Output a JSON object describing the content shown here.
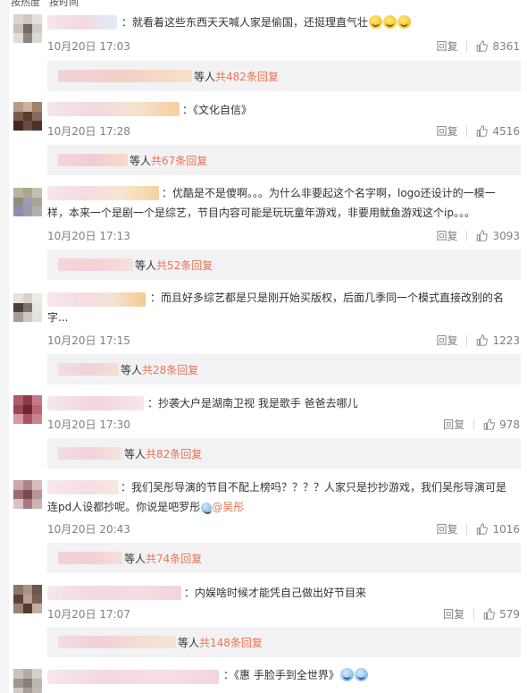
{
  "sort": {
    "hot": "按热度",
    "time": "按时间"
  },
  "labels": {
    "reply": "回复",
    "others": "等人"
  },
  "colors": {
    "accent": "#eb7350",
    "muted": "#808080",
    "subBg": "#f2f2f5"
  },
  "comments": [
    {
      "text": "：就看着这些东西天天喊人家是偷国，还挺理直气壮",
      "emoji": [
        "grin-icon",
        "grin-icon",
        "grin-icon"
      ],
      "date": "10月20日 17:03",
      "likes": "8361",
      "more": "共482条回复"
    },
    {
      "text": "：《文化自信》",
      "date": "10月20日 17:28",
      "likes": "4516",
      "more": "共67条回复"
    },
    {
      "text": "：优酷是不是傻啊。。。为什么非要起这个名字啊，logo还设计的一模一样，本来一个是剧一个是综艺，节目内容可能是玩玩童年游戏，非要用鱿鱼游戏这个ip。。。",
      "date": "10月20日 17:13",
      "likes": "3093",
      "more": "共52条回复"
    },
    {
      "text": "：而且好多综艺都是只是刚开始买版权，后面几季同一个模式直接改别的名字...",
      "date": "10月20日 17:15",
      "likes": "1223",
      "more": "共28条回复"
    },
    {
      "text": "：抄袭大户是湖南卫视 我是歌手 爸爸去哪儿",
      "date": "10月20日 17:30",
      "likes": "978",
      "more": "共82条回复"
    },
    {
      "text": "：我们吴彤导演的节目不配上榜吗？？？？人家只是抄抄游戏，我们吴彤导演可是连pd人设都抄呢。你说是吧罗彤",
      "mention": "@吴彤",
      "date": "10月20日 20:43",
      "likes": "1016",
      "more": "共74条回复"
    },
    {
      "text": "：内娱啥时候才能凭自己做出好节目来",
      "date": "10月20日 17:07",
      "likes": "579",
      "more": "共148条回复"
    },
    {
      "text": "：《惠 手脸手到全世界》"
    }
  ]
}
